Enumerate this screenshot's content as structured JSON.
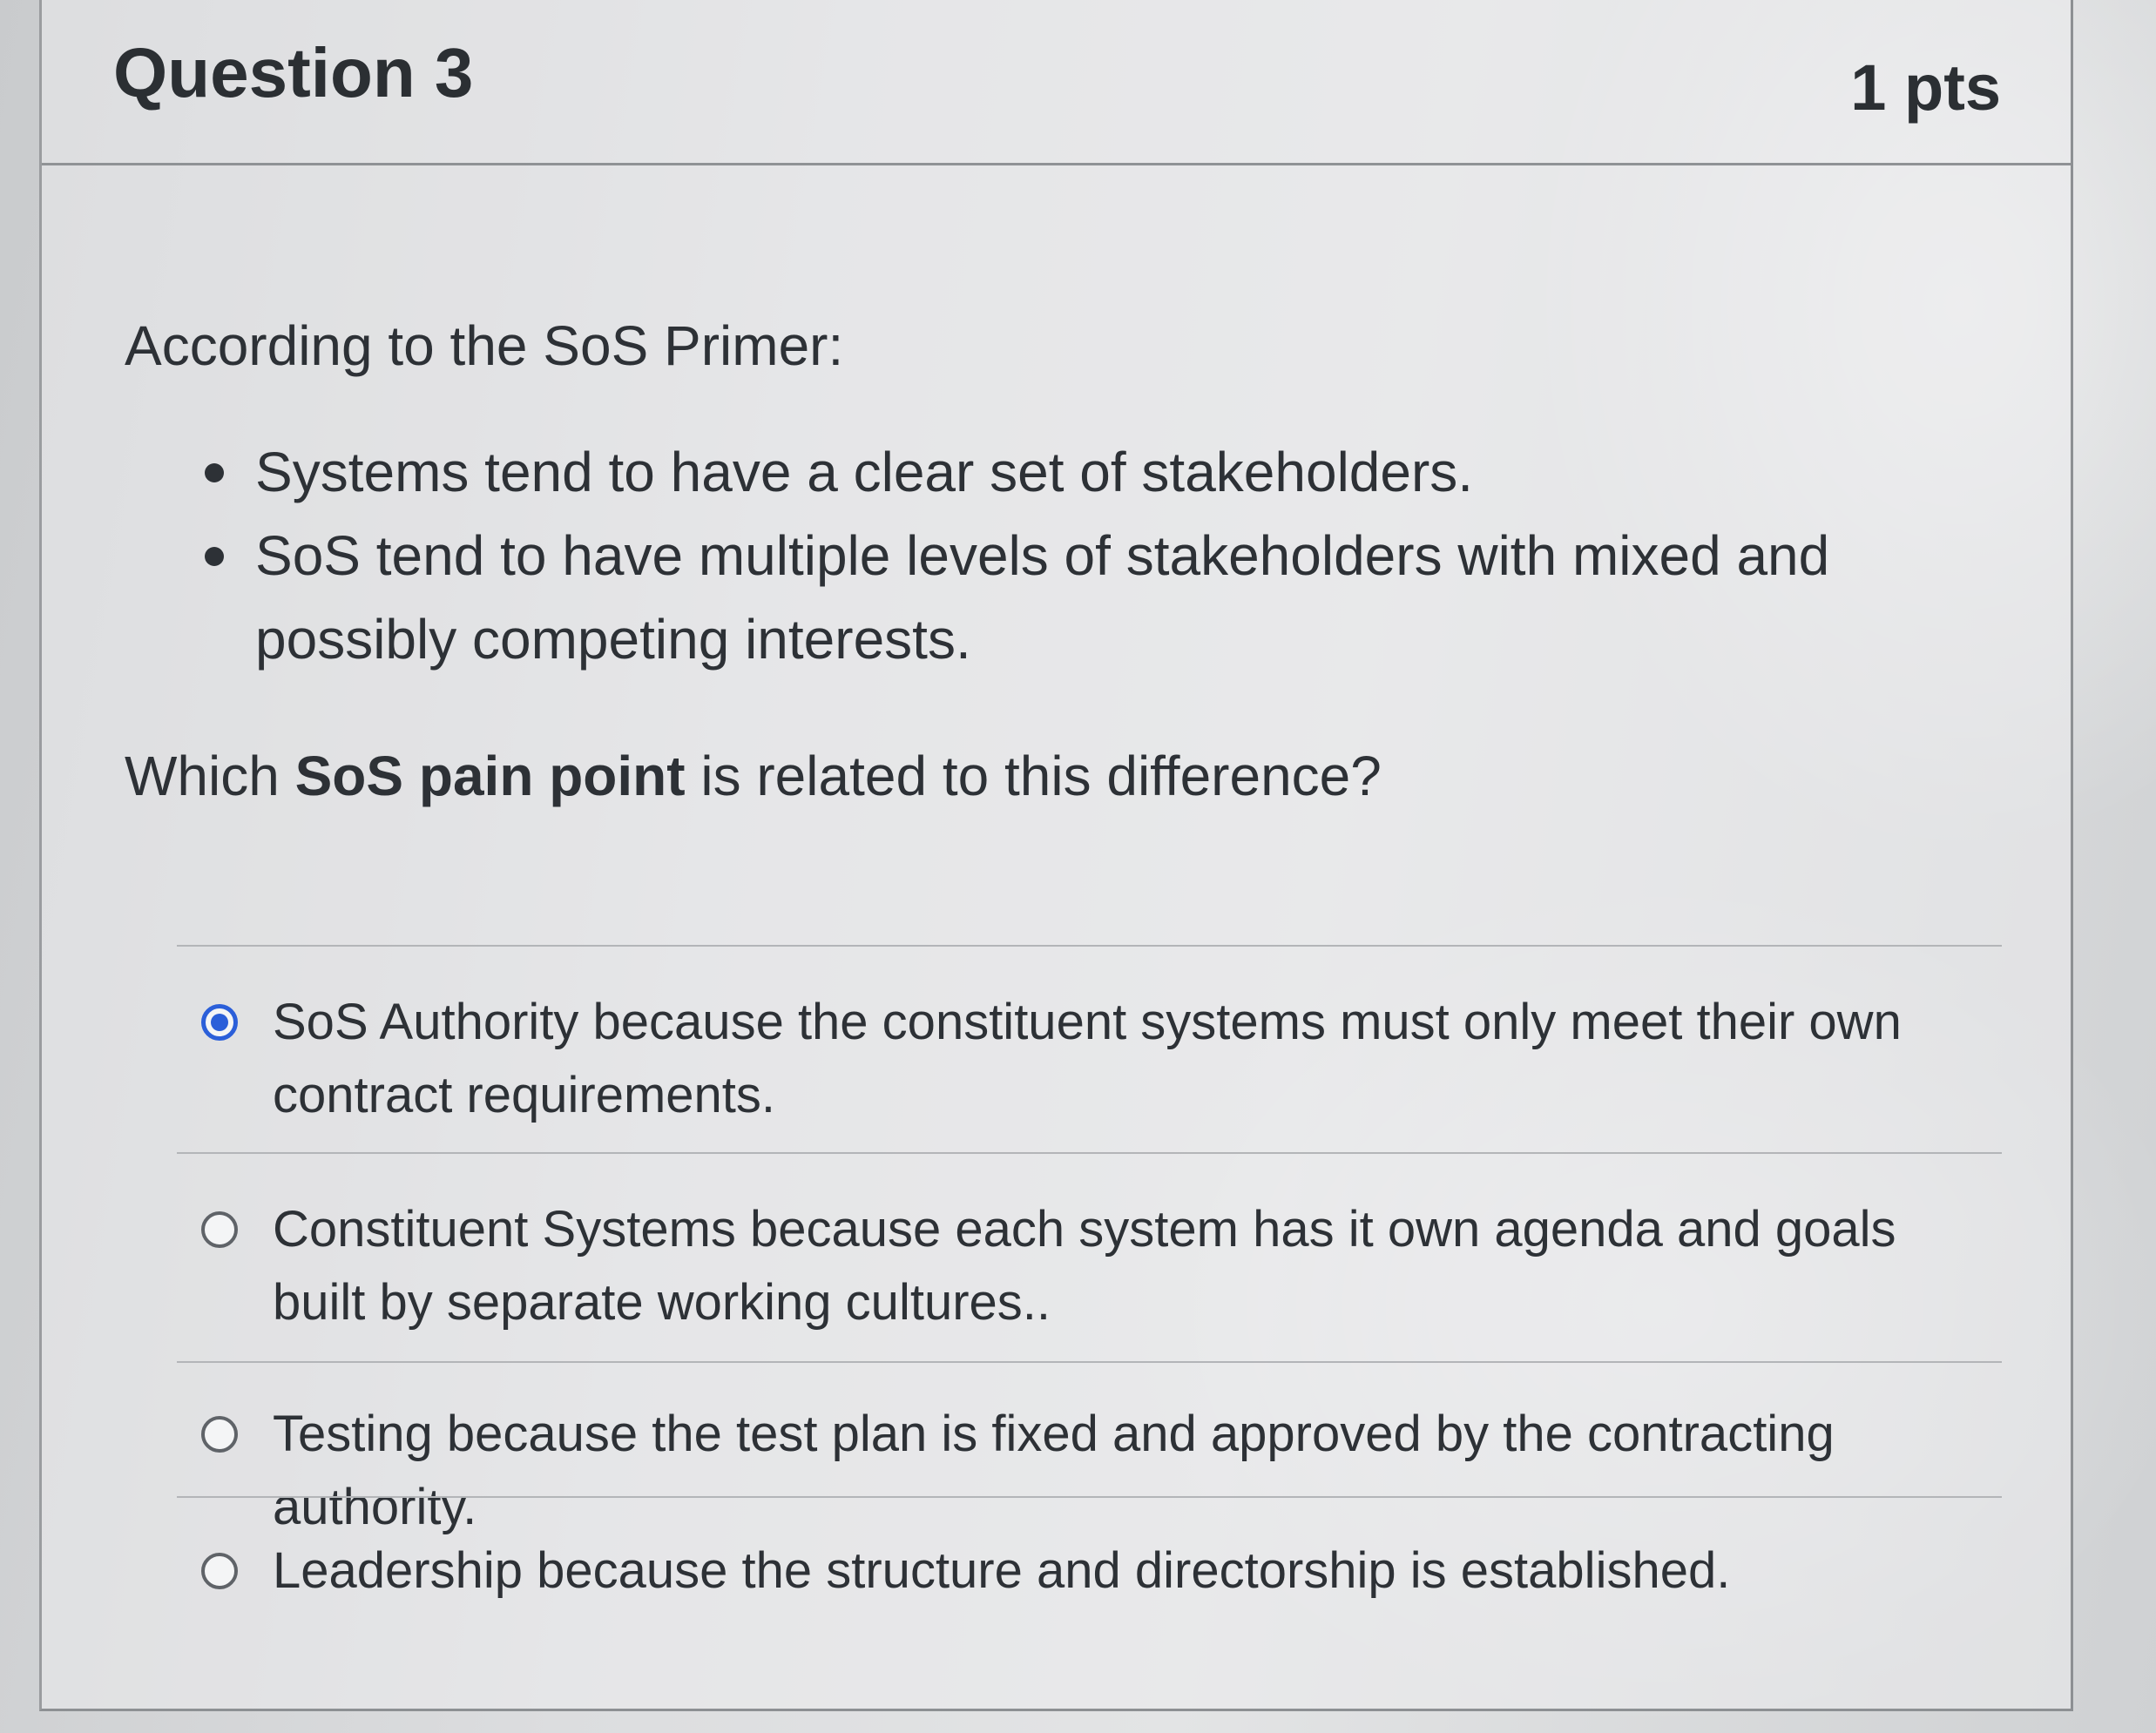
{
  "question": {
    "title": "Question 3",
    "points": "1 pts",
    "intro": "According to the SoS Primer:",
    "bullets": [
      "Systems tend to have a clear set of stakeholders.",
      "SoS tend to have multiple levels of stakeholders with mixed and possibly competing interests."
    ],
    "prompt_before": "Which ",
    "prompt_bold": "SoS pain point",
    "prompt_after": " is related to this difference?"
  },
  "answers": [
    {
      "label": "SoS Authority because the constituent systems must only meet their own contract requirements.",
      "selected": true
    },
    {
      "label": "Constituent Systems because each system has it own agenda and goals built by separate working cultures..",
      "selected": false
    },
    {
      "label": "Testing because the test plan is fixed and approved by the contracting authority.",
      "selected": false
    },
    {
      "label": "Leadership because the structure and directorship is established.",
      "selected": false
    }
  ],
  "colors": {
    "radio_selected": "#2b5fd9",
    "text": "#2d3136"
  },
  "icons": {
    "radio_selected": "radio-checked-icon",
    "radio_unselected": "radio-unchecked-icon",
    "bullet": "bullet-icon"
  }
}
